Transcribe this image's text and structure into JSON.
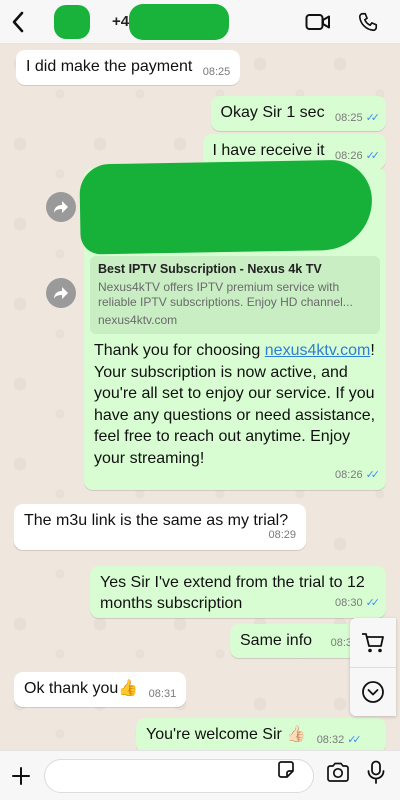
{
  "header": {
    "contact_visible": "+4",
    "icons": [
      "back-chevron-icon",
      "video-call-icon",
      "phone-icon"
    ]
  },
  "messages": [
    {
      "dir": "in",
      "text": "I did make the payment",
      "time": "08:25"
    },
    {
      "dir": "out",
      "text": "Okay Sir 1 sec",
      "time": "08:25",
      "read": true
    },
    {
      "dir": "out",
      "text": "I have receive it",
      "time": "08:26",
      "read": true
    },
    {
      "dir": "out",
      "time": "08:26",
      "read": true,
      "preview": {
        "title": "Best IPTV Subscription - Nexus 4k TV",
        "description": "Nexus4kTV offers IPTV premium service with reliable IPTV subscriptions. Enjoy HD channel...",
        "domain": "nexus4ktv.com"
      },
      "body_link": "nexus4ktv.com",
      "body_before": "Thank you for choosing",
      "body_after": "! Your subscription is now active, and you're all set to enjoy our service. If you have any questions or need assistance, feel free to reach out anytime. Enjoy your streaming!"
    },
    {
      "dir": "in",
      "text": "The m3u link is the same as my trial?",
      "time": "08:29"
    },
    {
      "dir": "out",
      "text": "Yes Sir I've extend from the trial to 12 months subscription",
      "time": "08:30",
      "read": true
    },
    {
      "dir": "out",
      "text": "Same info",
      "time": "08:3",
      "read": true
    },
    {
      "dir": "in",
      "text": "Ok thank you👍",
      "time": "08:31"
    },
    {
      "dir": "out",
      "text": "You're welcome Sir 👍🏻",
      "time": "08:32",
      "read": true
    }
  ],
  "composer": {
    "placeholder": ""
  },
  "colors": {
    "outgoing": "#d9fdd3",
    "incoming": "#ffffff",
    "read_ticks": "#3d8ef7",
    "redaction": "#19b33c"
  }
}
